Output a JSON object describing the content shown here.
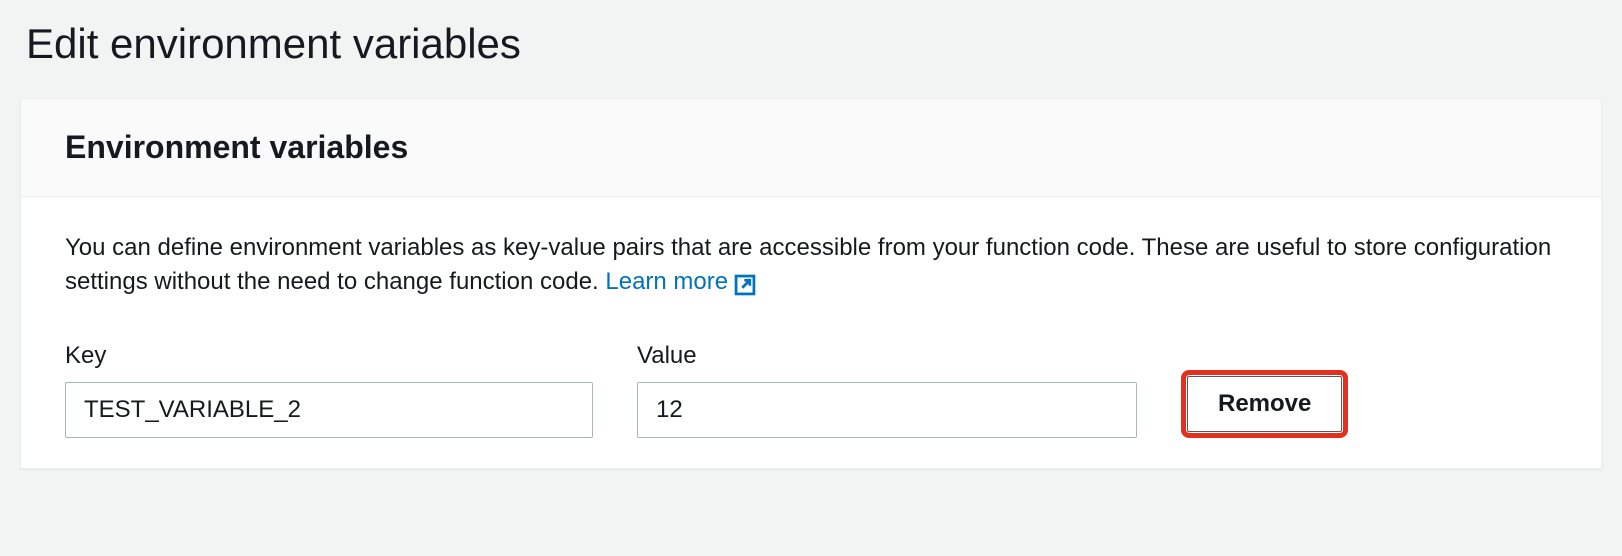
{
  "page": {
    "title": "Edit environment variables"
  },
  "panel": {
    "heading": "Environment variables",
    "description_part1": "You can define environment variables as key-value pairs that are accessible from your function code. These are useful to store configuration settings without the need to change function code. ",
    "learn_more_label": "Learn more"
  },
  "columns": {
    "key_label": "Key",
    "value_label": "Value"
  },
  "rows": [
    {
      "key": "TEST_VARIABLE_2",
      "value": "12",
      "remove_label": "Remove"
    }
  ],
  "colors": {
    "link": "#0073bb",
    "highlight": "#e3301f"
  }
}
